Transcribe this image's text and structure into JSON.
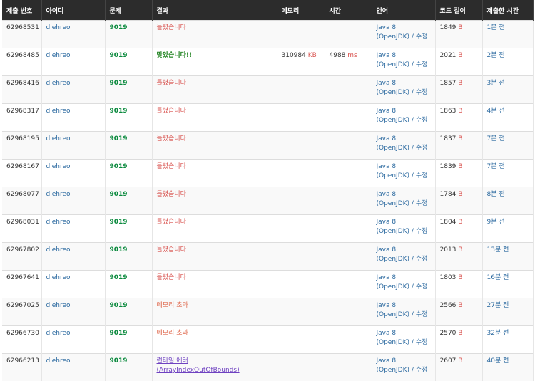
{
  "headers": [
    "제출 번호",
    "아이디",
    "문제",
    "결과",
    "메모리",
    "시간",
    "언어",
    "코드 길이",
    "제출한 시간"
  ],
  "language_line1": "Java 8",
  "language_line2_a": "(OpenJDK)",
  "language_line2_sep": " / ",
  "language_edit": "수정",
  "rows": [
    {
      "id": "62968531",
      "user": "diehreo",
      "problem": "9019",
      "result": "틀렸습니다",
      "rtype": "wrong",
      "memory": "",
      "memory_unit": "",
      "time": "",
      "time_unit": "",
      "length": "1849",
      "length_unit": "B",
      "submitted": "1분 전"
    },
    {
      "id": "62968485",
      "user": "diehreo",
      "problem": "9019",
      "result": "맞았습니다!!",
      "rtype": "ac",
      "memory": "310984",
      "memory_unit": "KB",
      "time": "4988",
      "time_unit": "ms",
      "length": "2021",
      "length_unit": "B",
      "submitted": "2분 전"
    },
    {
      "id": "62968416",
      "user": "diehreo",
      "problem": "9019",
      "result": "틀렸습니다",
      "rtype": "wrong",
      "memory": "",
      "memory_unit": "",
      "time": "",
      "time_unit": "",
      "length": "1857",
      "length_unit": "B",
      "submitted": "3분 전"
    },
    {
      "id": "62968317",
      "user": "diehreo",
      "problem": "9019",
      "result": "틀렸습니다",
      "rtype": "wrong",
      "memory": "",
      "memory_unit": "",
      "time": "",
      "time_unit": "",
      "length": "1863",
      "length_unit": "B",
      "submitted": "4분 전"
    },
    {
      "id": "62968195",
      "user": "diehreo",
      "problem": "9019",
      "result": "틀렸습니다",
      "rtype": "wrong",
      "memory": "",
      "memory_unit": "",
      "time": "",
      "time_unit": "",
      "length": "1837",
      "length_unit": "B",
      "submitted": "7분 전"
    },
    {
      "id": "62968167",
      "user": "diehreo",
      "problem": "9019",
      "result": "틀렸습니다",
      "rtype": "wrong",
      "memory": "",
      "memory_unit": "",
      "time": "",
      "time_unit": "",
      "length": "1839",
      "length_unit": "B",
      "submitted": "7분 전"
    },
    {
      "id": "62968077",
      "user": "diehreo",
      "problem": "9019",
      "result": "틀렸습니다",
      "rtype": "wrong",
      "memory": "",
      "memory_unit": "",
      "time": "",
      "time_unit": "",
      "length": "1784",
      "length_unit": "B",
      "submitted": "8분 전"
    },
    {
      "id": "62968031",
      "user": "diehreo",
      "problem": "9019",
      "result": "틀렸습니다",
      "rtype": "wrong",
      "memory": "",
      "memory_unit": "",
      "time": "",
      "time_unit": "",
      "length": "1804",
      "length_unit": "B",
      "submitted": "9분 전"
    },
    {
      "id": "62967802",
      "user": "diehreo",
      "problem": "9019",
      "result": "틀렸습니다",
      "rtype": "wrong",
      "memory": "",
      "memory_unit": "",
      "time": "",
      "time_unit": "",
      "length": "2013",
      "length_unit": "B",
      "submitted": "13분 전"
    },
    {
      "id": "62967641",
      "user": "diehreo",
      "problem": "9019",
      "result": "틀렸습니다",
      "rtype": "wrong",
      "memory": "",
      "memory_unit": "",
      "time": "",
      "time_unit": "",
      "length": "1803",
      "length_unit": "B",
      "submitted": "16분 전"
    },
    {
      "id": "62967025",
      "user": "diehreo",
      "problem": "9019",
      "result": "메모리 초과",
      "rtype": "mem",
      "memory": "",
      "memory_unit": "",
      "time": "",
      "time_unit": "",
      "length": "2566",
      "length_unit": "B",
      "submitted": "27분 전"
    },
    {
      "id": "62966730",
      "user": "diehreo",
      "problem": "9019",
      "result": "메모리 초과",
      "rtype": "mem",
      "memory": "",
      "memory_unit": "",
      "time": "",
      "time_unit": "",
      "length": "2570",
      "length_unit": "B",
      "submitted": "32분 전"
    },
    {
      "id": "62966213",
      "user": "diehreo",
      "problem": "9019",
      "result": "런타임 에러 (ArrayIndexOutOfBounds)",
      "rtype": "rte",
      "memory": "",
      "memory_unit": "",
      "time": "",
      "time_unit": "",
      "length": "2607",
      "length_unit": "B",
      "submitted": "40분 전"
    }
  ],
  "colors": {
    "header_bg": "#2c2c2c",
    "link": "#2c6aa0",
    "problem": "#0b8a3e",
    "wrong": "#d9534f",
    "accepted": "#1a7f1a",
    "memory_exceeded": "#e06b50",
    "runtime_error": "#6f42c1"
  }
}
